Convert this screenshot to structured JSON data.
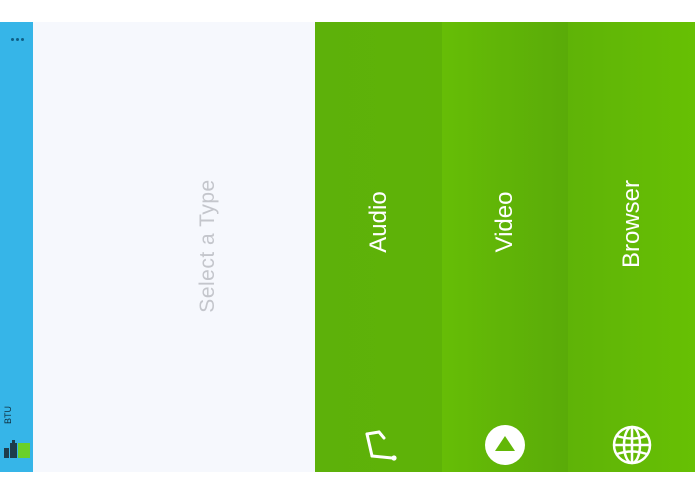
{
  "app": {
    "name": "BTU"
  },
  "menu": {
    "overflow_icon": "overflow-dots-icon"
  },
  "content": {
    "prompt": "Select a Type"
  },
  "types": [
    {
      "label": "Audio",
      "icon": "audio-icon"
    },
    {
      "label": "Video",
      "icon": "play-icon"
    },
    {
      "label": "Browser",
      "icon": "globe-icon"
    }
  ],
  "colors": {
    "side_strip": "#36b5e8",
    "content_bg": "#f6f8fd",
    "accent_green": "#62b707",
    "prompt_text": "#c4c6cc",
    "label_text": "#ffffff"
  }
}
